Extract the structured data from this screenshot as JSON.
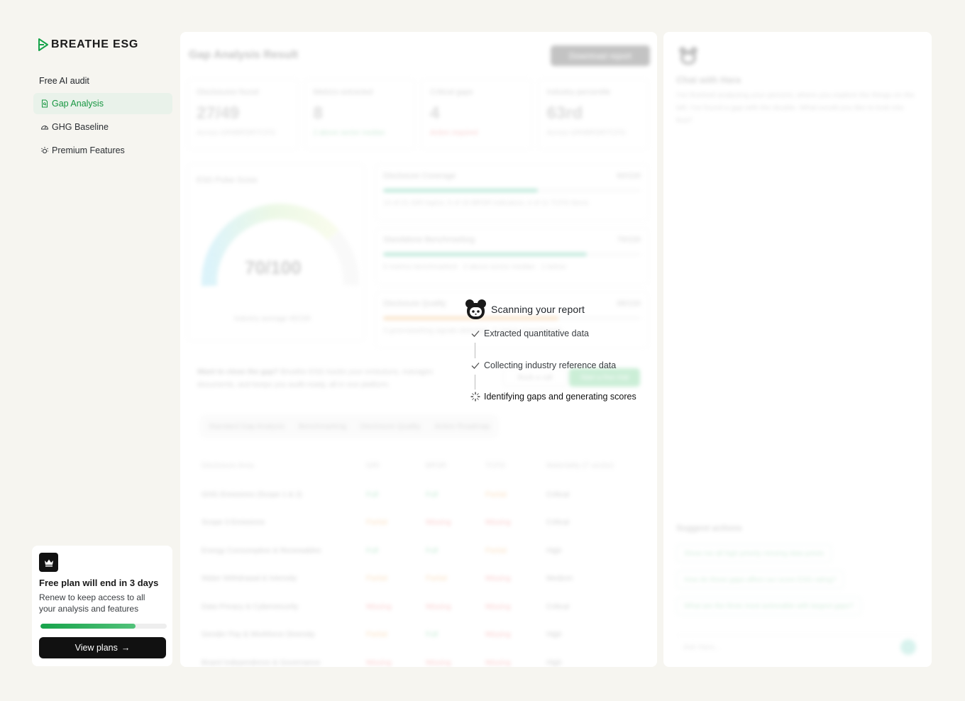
{
  "brand": {
    "name": "BREATHE ESG"
  },
  "sidebar": {
    "section_label": "Free AI audit",
    "items": [
      {
        "label": "Gap Analysis",
        "icon": "document-icon",
        "active": true
      },
      {
        "label": "GHG Baseline",
        "icon": "gauge-icon",
        "active": false
      },
      {
        "label": "Premium Features",
        "icon": "sparkle-icon",
        "active": false
      }
    ],
    "plan": {
      "title": "Free plan will end in 3 days",
      "subtitle": "Renew to keep access to all your analysis and features",
      "progress_fraction": 0.75,
      "button_label": "View plans"
    }
  },
  "main": {
    "title": "Gap Analysis Result",
    "download_label": "Download report",
    "stats": [
      {
        "label": "Disclosures found",
        "value": "27/49",
        "foot": "Across GRI/BRSR/TCFD",
        "tone": "gray"
      },
      {
        "label": "Metrics extracted",
        "value": "8",
        "foot": "2 above sector median",
        "tone": "green"
      },
      {
        "label": "Critical gaps",
        "value": "4",
        "foot": "Action required",
        "tone": "red"
      },
      {
        "label": "Industry percentile",
        "value": "63rd",
        "foot": "Across GRI/BRSR/TCFD",
        "tone": "gray"
      }
    ],
    "gauge": {
      "label": "ESG Pulse Score",
      "value": "70/100",
      "foot": "Industry average 45/100"
    },
    "metrics": [
      {
        "label": "Disclosure Coverage",
        "score": "60/100",
        "fill": 0.6,
        "color": "#4bbf9a",
        "foot": "14 of 21 GRI topics; 6 of 15 BRSR indicators; 4 of 11 TCFD items"
      },
      {
        "label": "Standalone Benchmarking",
        "score": "79/100",
        "fill": 0.79,
        "color": "#4bbf9a",
        "foot": "5 metrics benchmarked · 2 above sector median · 1 below"
      },
      {
        "label": "Disclosure Quality",
        "score": "68/100",
        "fill": 0.68,
        "color": "#f0b36a",
        "foot": "3 greenwashing signals detected · 2 vague commitments"
      }
    ],
    "cta": {
      "text_bold": "Want to close the gap?",
      "text": "Breathe ESG tracks your emissions, manages documents, and keeps you audit-ready, all in one platform.",
      "secondary": "Book a call",
      "primary": "Start a free trial"
    },
    "tabs": [
      "Standard Gap Analysis",
      "Benchmarking",
      "Disclosure Quality",
      "Action Roadmap"
    ],
    "table": {
      "headers": [
        "Disclosure Area",
        "GRI",
        "BRSR",
        "TCFD",
        "Materiality (7 sector)"
      ],
      "rows": [
        [
          "GHG Emissions (Scope 1 & 2)",
          "Full",
          "Full",
          "Partial",
          "Critical"
        ],
        [
          "Scope 3 Emissions",
          "Partial",
          "Missing",
          "Missing",
          "Critical"
        ],
        [
          "Energy Consumption & Renewables",
          "Full",
          "Full",
          "Partial",
          "High"
        ],
        [
          "Water Withdrawal & Intensity",
          "Partial",
          "Partial",
          "Missing",
          "Medium"
        ],
        [
          "Data Privacy & Cybersecurity",
          "Missing",
          "Missing",
          "Missing",
          "Critical"
        ],
        [
          "Gender Pay & Workforce Diversity",
          "Partial",
          "Full",
          "Missing",
          "High"
        ],
        [
          "Board Independence & Governance",
          "Missing",
          "Missing",
          "Missing",
          "High"
        ]
      ]
    }
  },
  "chat": {
    "title": "Chat with Hara",
    "description": "I've finished analysing your percent, where you explore the things on the left. I've found a gap with the double. What would you like to look into first?",
    "suggest_title": "Suggest actions",
    "suggestions": [
      "Show me all high priority missing data points",
      "How do these gaps affect our score ESG rating?",
      "What are the three most actionable with largest gaps?"
    ],
    "input_placeholder": "Ask Hara..."
  },
  "scan": {
    "title": "Scanning your report",
    "steps": [
      {
        "label": "Extracted quantitative data",
        "status": "done"
      },
      {
        "label": "Collecting industry reference data",
        "status": "done"
      },
      {
        "label": "Identifying gaps and generating scores",
        "status": "in-progress"
      }
    ]
  },
  "colors": {
    "accent": "#169640",
    "active_bg": "#e9f2ea",
    "dark": "#111111"
  }
}
